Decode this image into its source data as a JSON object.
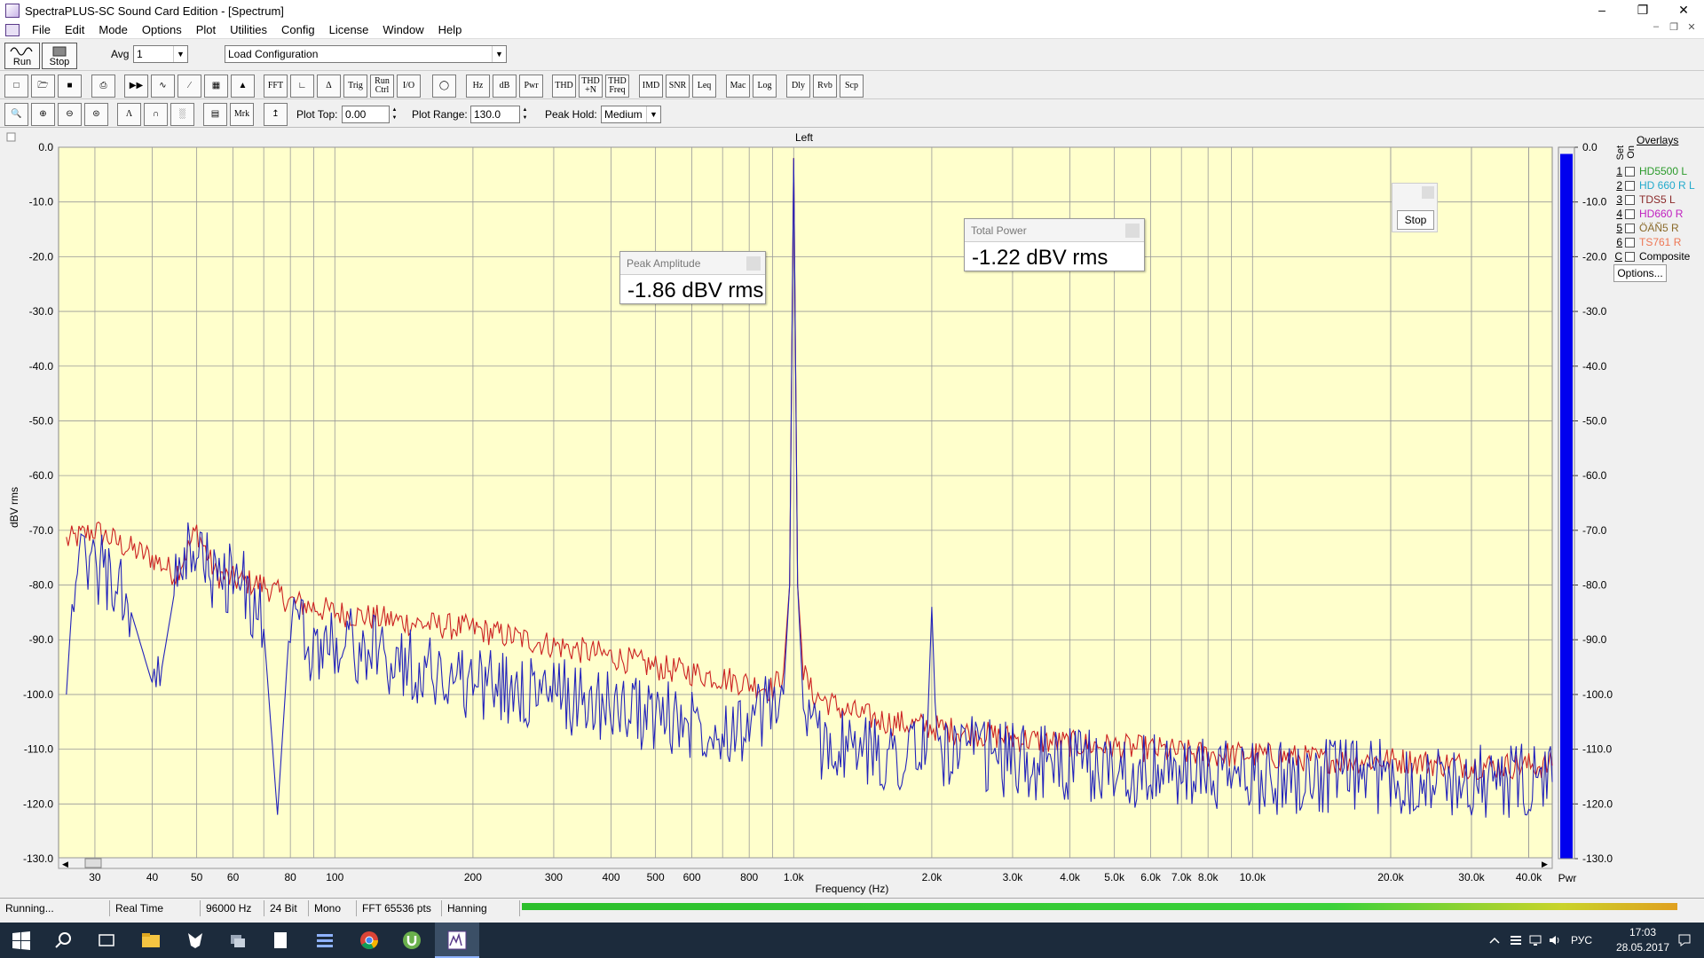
{
  "window": {
    "title": "SpectraPLUS-SC Sound Card Edition - [Spectrum]"
  },
  "menu": [
    "File",
    "Edit",
    "Mode",
    "Options",
    "Plot",
    "Utilities",
    "Config",
    "License",
    "Window",
    "Help"
  ],
  "toolbar1": {
    "run_label": "Run",
    "stop_label": "Stop",
    "avg_label": "Avg",
    "avg_value": "1",
    "config_value": "Load Configuration"
  },
  "toolbar2": {
    "buttons": [
      "FFT",
      "Trig",
      "Run Ctrl",
      "I/O",
      "Hz",
      "dB",
      "Pwr",
      "THD",
      "THD +N",
      "THD Freq",
      "IMD",
      "SNR",
      "Leq",
      "Mac",
      "Log",
      "Dly",
      "Rvb",
      "Scp"
    ]
  },
  "toolbar3": {
    "mrk_label": "Mrk",
    "plot_top_label": "Plot Top:",
    "plot_top_value": "0.00",
    "plot_range_label": "Plot Range:",
    "plot_range_value": "130.0",
    "peak_hold_label": "Peak Hold:",
    "peak_hold_value": "Medium"
  },
  "plot": {
    "channel_title": "Left",
    "ylabel": "dBV rms",
    "xlabel": "Frequency (Hz)",
    "pwr_label": "Pwr"
  },
  "popups": {
    "peak_amplitude": {
      "title": "Peak Amplitude",
      "value": "-1.86 dBV rms"
    },
    "total_power": {
      "title": "Total Power",
      "value": "-1.22 dBV rms"
    },
    "stop_button": "Stop"
  },
  "overlays": {
    "title": "Overlays",
    "set_label": "Set",
    "on_label": "On",
    "items": [
      {
        "num": "1",
        "name": "HD5500 L",
        "color": "#2a9a2a"
      },
      {
        "num": "2",
        "name": "HD 660 R L",
        "color": "#22aacc"
      },
      {
        "num": "3",
        "name": "TDS5 L",
        "color": "#8a2a2a"
      },
      {
        "num": "4",
        "name": "HD660 R",
        "color": "#c020c0"
      },
      {
        "num": "5",
        "name": "ÖÄÑ5 R",
        "color": "#8a6a2a"
      },
      {
        "num": "6",
        "name": "TS761 R",
        "color": "#ee7755"
      },
      {
        "num": "C",
        "name": "Composite",
        "color": "#000000"
      }
    ],
    "options_label": "Options..."
  },
  "status": {
    "state": "Running...",
    "mode": "Real Time",
    "rate": "96000 Hz",
    "bits": "24 Bit",
    "channels": "Mono",
    "fft": "FFT 65536 pts",
    "window": "Hanning"
  },
  "tray": {
    "lang": "РУС",
    "time": "17:03",
    "date": "28.05.2017"
  },
  "chart_data": {
    "type": "line",
    "title": "Left",
    "xlabel": "Frequency (Hz)",
    "ylabel": "dBV rms",
    "x_scale": "log",
    "xlim": [
      25,
      45000
    ],
    "ylim": [
      -130,
      0
    ],
    "y_ticks": [
      "0.0",
      "-10.0",
      "-20.0",
      "-30.0",
      "-40.0",
      "-50.0",
      "-60.0",
      "-70.0",
      "-80.0",
      "-90.0",
      "-100.0",
      "-110.0",
      "-120.0",
      "-130.0"
    ],
    "x_ticks": [
      {
        "v": 30,
        "label": "30"
      },
      {
        "v": 40,
        "label": "40"
      },
      {
        "v": 50,
        "label": "50"
      },
      {
        "v": 60,
        "label": "60"
      },
      {
        "v": 80,
        "label": "80"
      },
      {
        "v": 100,
        "label": "100"
      },
      {
        "v": 200,
        "label": "200"
      },
      {
        "v": 300,
        "label": "300"
      },
      {
        "v": 400,
        "label": "400"
      },
      {
        "v": 500,
        "label": "500"
      },
      {
        "v": 600,
        "label": "600"
      },
      {
        "v": 800,
        "label": "800"
      },
      {
        "v": 1000,
        "label": "1.0k"
      },
      {
        "v": 2000,
        "label": "2.0k"
      },
      {
        "v": 3000,
        "label": "3.0k"
      },
      {
        "v": 4000,
        "label": "4.0k"
      },
      {
        "v": 5000,
        "label": "5.0k"
      },
      {
        "v": 6000,
        "label": "6.0k"
      },
      {
        "v": 7000,
        "label": "7.0k"
      },
      {
        "v": 8000,
        "label": "8.0k"
      },
      {
        "v": 10000,
        "label": "10.0k"
      },
      {
        "v": 20000,
        "label": "20.0k"
      },
      {
        "v": 30000,
        "label": "30.0k"
      },
      {
        "v": 40000,
        "label": "40.0k"
      }
    ],
    "grid": true,
    "series": [
      {
        "color": "#cc2222",
        "x": [
          26,
          30,
          35,
          40,
          45,
          50,
          55,
          60,
          70,
          80,
          100,
          150,
          200,
          300,
          400,
          500,
          600,
          700,
          800,
          900,
          950,
          980,
          1000,
          1020,
          1050,
          1100,
          1300,
          1600,
          2000,
          3000,
          4000,
          6000,
          8000,
          10000,
          15000,
          20000,
          30000,
          40000,
          45000
        ],
        "y": [
          -72,
          -70,
          -73,
          -75,
          -78,
          -70,
          -78,
          -79,
          -80,
          -83,
          -85,
          -87,
          -88,
          -91,
          -93,
          -95,
          -96,
          -97,
          -98,
          -99,
          -96,
          -80,
          -2,
          -80,
          -96,
          -100,
          -103,
          -105,
          -106,
          -108,
          -109,
          -110,
          -111,
          -111,
          -112,
          -112,
          -113,
          -113,
          -113
        ]
      },
      {
        "color": "#2222bb",
        "x": [
          26,
          27,
          30,
          33,
          36,
          40,
          42,
          45,
          50,
          55,
          60,
          65,
          70,
          75,
          80,
          90,
          100,
          150,
          200,
          300,
          400,
          500,
          600,
          800,
          950,
          980,
          1000,
          1020,
          1050,
          1100,
          1300,
          1600,
          1950,
          2000,
          2050,
          3000,
          4000,
          6000,
          8000,
          10000,
          15000,
          20000,
          30000,
          40000,
          45000
        ],
        "y": [
          -100,
          -78,
          -76,
          -80,
          -85,
          -98,
          -95,
          -80,
          -72,
          -80,
          -78,
          -82,
          -88,
          -122,
          -85,
          -92,
          -90,
          -95,
          -98,
          -100,
          -102,
          -104,
          -105,
          -106,
          -100,
          -80,
          -2,
          -80,
          -102,
          -108,
          -110,
          -111,
          -110,
          -84,
          -110,
          -112,
          -113,
          -114,
          -115,
          -115,
          -115,
          -115,
          -116,
          -116,
          -116
        ]
      }
    ],
    "level_meter": {
      "label": "Pwr",
      "value_dbv": -1.22,
      "color": "#0000ee"
    }
  }
}
